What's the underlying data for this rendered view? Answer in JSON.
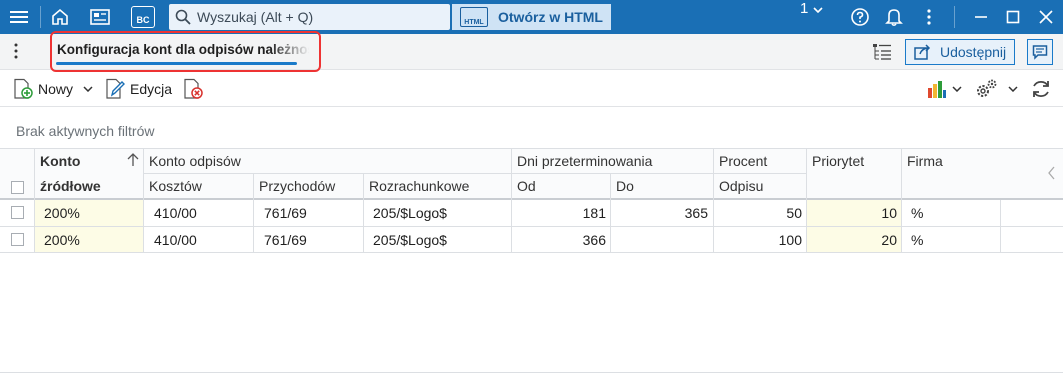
{
  "titlebar": {
    "search_placeholder": "Wyszukaj (Alt + Q)",
    "bc_label": "BC",
    "open_html_label": "Otwórz w HTML",
    "html_badge": "HTML",
    "company_number": "1"
  },
  "tab": {
    "title": "Konfiguracja kont dla odpisów należności"
  },
  "actions": {
    "share_label": "Udostępnij"
  },
  "toolbar": {
    "new_label": "Nowy",
    "edit_label": "Edycja"
  },
  "filter": {
    "text": "Brak aktywnych filtrów"
  },
  "grid": {
    "headers": {
      "konto_top": "Konto",
      "konto_bottom": "źródłowe",
      "konto_odpisow": "Konto odpisów",
      "kosztow": "Kosztów",
      "przychodow": "Przychodów",
      "rozrachunkowe": "Rozrachunkowe",
      "dni": "Dni przeterminowania",
      "od": "Od",
      "do": "Do",
      "procent_top": "Procent",
      "procent_bottom": "Odpisu",
      "priorytet": "Priorytet",
      "firma": "Firma"
    },
    "rows": [
      {
        "konto": "200%",
        "kosztow": "410/00",
        "przychodow": "761/69",
        "rozrachunkowe": "205/$Logo$",
        "od": "181",
        "do": "365",
        "procent": "50",
        "priorytet": "10",
        "firma": "%"
      },
      {
        "konto": "200%",
        "kosztow": "410/00",
        "przychodow": "761/69",
        "rozrachunkowe": "205/$Logo$",
        "od": "366",
        "do": "",
        "procent": "100",
        "priorytet": "20",
        "firma": "%"
      }
    ]
  },
  "colors": {
    "titlebar": "#1a6fb5",
    "accent": "#1a7ac9",
    "highlight_border": "#ee3333",
    "yellow_cell": "#fdfce6"
  }
}
